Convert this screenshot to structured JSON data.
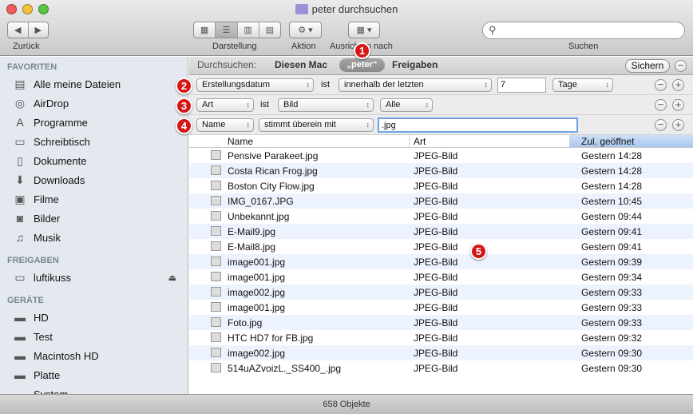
{
  "window": {
    "title": "peter durchsuchen"
  },
  "toolbar": {
    "back_label": "Zurück",
    "view_label": "Darstellung",
    "action_label": "Aktion",
    "arrange_label": "Ausrichten nach",
    "search_label": "Suchen",
    "search_value": ""
  },
  "scope": {
    "label": "Durchsuchen:",
    "this_mac": "Diesen Mac",
    "folder": "„peter“",
    "shared": "Freigaben",
    "save": "Sichern"
  },
  "criteria": [
    {
      "attribute": "Erstellungsdatum",
      "op_label": "ist",
      "op": "innerhalb der letzten",
      "value": "7",
      "unit": "Tage"
    },
    {
      "attribute": "Art",
      "op_label": "ist",
      "op": "Bild",
      "value": "Alle"
    },
    {
      "attribute": "Name",
      "op": "stimmt überein mit",
      "value": ".jpg"
    }
  ],
  "columns": {
    "name": "Name",
    "kind": "Art",
    "opened": "Zul. geöffnet"
  },
  "files": [
    {
      "name": "Pensive Parakeet.jpg",
      "kind": "JPEG-Bild",
      "opened": "Gestern 14:28"
    },
    {
      "name": "Costa Rican Frog.jpg",
      "kind": "JPEG-Bild",
      "opened": "Gestern 14:28"
    },
    {
      "name": "Boston City Flow.jpg",
      "kind": "JPEG-Bild",
      "opened": "Gestern 14:28"
    },
    {
      "name": "IMG_0167.JPG",
      "kind": "JPEG-Bild",
      "opened": "Gestern 10:45"
    },
    {
      "name": "Unbekannt.jpg",
      "kind": "JPEG-Bild",
      "opened": "Gestern 09:44"
    },
    {
      "name": "E-Mail9.jpg",
      "kind": "JPEG-Bild",
      "opened": "Gestern 09:41"
    },
    {
      "name": "E-Mail8.jpg",
      "kind": "JPEG-Bild",
      "opened": "Gestern 09:41"
    },
    {
      "name": "image001.jpg",
      "kind": "JPEG-Bild",
      "opened": "Gestern 09:39"
    },
    {
      "name": "image001.jpg",
      "kind": "JPEG-Bild",
      "opened": "Gestern 09:34"
    },
    {
      "name": "image002.jpg",
      "kind": "JPEG-Bild",
      "opened": "Gestern 09:33"
    },
    {
      "name": "image001.jpg",
      "kind": "JPEG-Bild",
      "opened": "Gestern 09:33"
    },
    {
      "name": "Foto.jpg",
      "kind": "JPEG-Bild",
      "opened": "Gestern 09:33"
    },
    {
      "name": "HTC HD7 for FB.jpg",
      "kind": "JPEG-Bild",
      "opened": "Gestern 09:32"
    },
    {
      "name": "image002.jpg",
      "kind": "JPEG-Bild",
      "opened": "Gestern 09:30"
    },
    {
      "name": "514uAZvoizL._SS400_.jpg",
      "kind": "JPEG-Bild",
      "opened": "Gestern 09:30"
    }
  ],
  "sidebar": {
    "favorites_header": "FAVORITEN",
    "favorites": [
      {
        "label": "Alle meine Dateien",
        "icon": "all-files-icon"
      },
      {
        "label": "AirDrop",
        "icon": "airdrop-icon"
      },
      {
        "label": "Programme",
        "icon": "applications-icon"
      },
      {
        "label": "Schreibtisch",
        "icon": "desktop-icon"
      },
      {
        "label": "Dokumente",
        "icon": "documents-icon"
      },
      {
        "label": "Downloads",
        "icon": "downloads-icon"
      },
      {
        "label": "Filme",
        "icon": "movies-icon"
      },
      {
        "label": "Bilder",
        "icon": "pictures-icon"
      },
      {
        "label": "Musik",
        "icon": "music-icon"
      }
    ],
    "shared_header": "FREIGABEN",
    "shared": [
      {
        "label": "luftikuss",
        "icon": "network-computer-icon"
      }
    ],
    "devices_header": "GERÄTE",
    "devices": [
      {
        "label": "HD",
        "icon": "hard-drive-icon"
      },
      {
        "label": "Test",
        "icon": "hard-drive-icon"
      },
      {
        "label": "Macintosh HD",
        "icon": "hard-drive-icon"
      },
      {
        "label": "Platte",
        "icon": "hard-drive-icon"
      },
      {
        "label": "System",
        "icon": "hard-drive-icon"
      }
    ]
  },
  "annotations": [
    "1",
    "2",
    "3",
    "4",
    "5"
  ],
  "status": {
    "count": "658 Objekte"
  },
  "colors": {
    "badge": "#d41616",
    "sidebar_bg": "#e4e9ef",
    "row_alt": "#edf3fe",
    "sorted_header": "#bcd5f3"
  }
}
